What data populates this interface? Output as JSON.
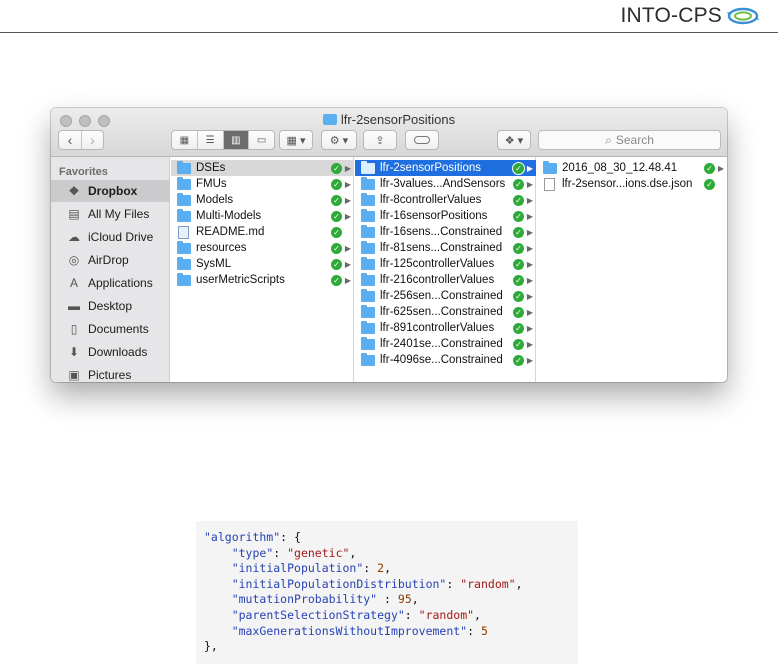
{
  "header": {
    "brand": "INTO-CPS"
  },
  "finder": {
    "title": "lfr-2sensorPositions",
    "search_placeholder": "Search",
    "sidebar": {
      "heading": "Favorites",
      "items": [
        {
          "label": "Dropbox",
          "icon": "dropbox-icon",
          "selected": true
        },
        {
          "label": "All My Files",
          "icon": "all-files-icon"
        },
        {
          "label": "iCloud Drive",
          "icon": "cloud-icon"
        },
        {
          "label": "AirDrop",
          "icon": "airdrop-icon"
        },
        {
          "label": "Applications",
          "icon": "applications-icon"
        },
        {
          "label": "Desktop",
          "icon": "desktop-icon"
        },
        {
          "label": "Documents",
          "icon": "documents-icon"
        },
        {
          "label": "Downloads",
          "icon": "downloads-icon"
        },
        {
          "label": "Pictures",
          "icon": "pictures-icon"
        }
      ]
    },
    "column1": [
      {
        "name": "DSEs",
        "kind": "folder",
        "synced": true,
        "has_children": true,
        "highlight": "gray"
      },
      {
        "name": "FMUs",
        "kind": "folder",
        "synced": true,
        "has_children": true
      },
      {
        "name": "Models",
        "kind": "folder",
        "synced": true,
        "has_children": true
      },
      {
        "name": "Multi-Models",
        "kind": "folder",
        "synced": true,
        "has_children": true
      },
      {
        "name": "README.md",
        "kind": "markdown",
        "synced": true,
        "has_children": false
      },
      {
        "name": "resources",
        "kind": "folder",
        "synced": true,
        "has_children": true
      },
      {
        "name": "SysML",
        "kind": "folder",
        "synced": true,
        "has_children": true
      },
      {
        "name": "userMetricScripts",
        "kind": "folder",
        "synced": true,
        "has_children": true
      }
    ],
    "column2": [
      {
        "name": "lfr-2sensorPositions",
        "synced": true,
        "highlight": "blue"
      },
      {
        "name": "lfr-3values...AndSensors",
        "synced": true
      },
      {
        "name": "lfr-8controllerValues",
        "synced": true
      },
      {
        "name": "lfr-16sensorPositions",
        "synced": true
      },
      {
        "name": "lfr-16sens...Constrained",
        "synced": true
      },
      {
        "name": "lfr-81sens...Constrained",
        "synced": true
      },
      {
        "name": "lfr-125controllerValues",
        "synced": true
      },
      {
        "name": "lfr-216controllerValues",
        "synced": true
      },
      {
        "name": "lfr-256sen...Constrained",
        "synced": true
      },
      {
        "name": "lfr-625sen...Constrained",
        "synced": true
      },
      {
        "name": "lfr-891controllerValues",
        "synced": true
      },
      {
        "name": "lfr-2401se...Constrained",
        "synced": true
      },
      {
        "name": "lfr-4096se...Constrained",
        "synced": true
      }
    ],
    "column3": [
      {
        "name": "2016_08_30_12.48.41",
        "kind": "folder",
        "synced": true,
        "has_children": true
      },
      {
        "name": "lfr-2sensor...ions.dse.json",
        "kind": "file",
        "synced": true,
        "has_children": false
      }
    ]
  },
  "code_snippet": {
    "lines": [
      {
        "key": "\"algorithm\"",
        "punct": ": {",
        "indent": 0
      },
      {
        "key": "\"type\"",
        "punct": ": ",
        "value": "\"genetic\"",
        "vtype": "string",
        "tail": ",",
        "indent": 1
      },
      {
        "key": "\"initialPopulation\"",
        "punct": ": ",
        "value": "2",
        "vtype": "number",
        "tail": ",",
        "indent": 1
      },
      {
        "key": "\"initialPopulationDistribution\"",
        "punct": ": ",
        "value": "\"random\"",
        "vtype": "string",
        "tail": ",",
        "indent": 1
      },
      {
        "key": "\"mutationProbability\"",
        "punct": " : ",
        "value": "95",
        "vtype": "number",
        "tail": ",",
        "indent": 1
      },
      {
        "key": "\"parentSelectionStrategy\"",
        "punct": ": ",
        "value": "\"random\"",
        "vtype": "string",
        "tail": ",",
        "indent": 1
      },
      {
        "key": "\"maxGenerationsWithoutImprovement\"",
        "punct": ": ",
        "value": "5",
        "vtype": "number",
        "tail": "",
        "indent": 1
      },
      {
        "key": "",
        "punct": "},",
        "indent": 0
      }
    ]
  },
  "colors": {
    "selection_blue": "#1f6fe0",
    "folder_blue": "#5aaef0",
    "sync_green": "#2eaa3a",
    "json_key": "#2643b5",
    "json_string": "#a31818",
    "json_number": "#8a3b00"
  }
}
